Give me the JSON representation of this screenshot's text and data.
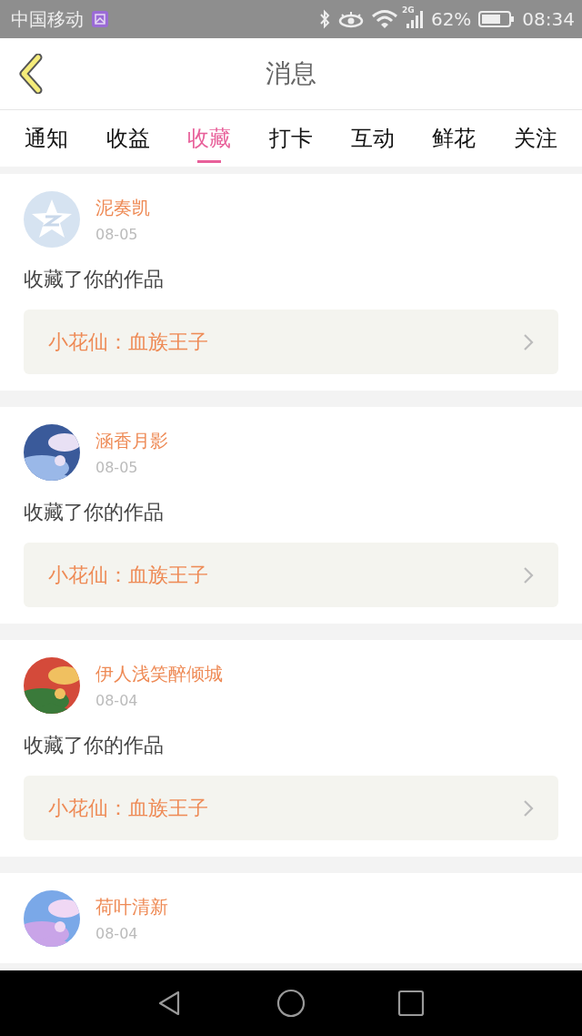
{
  "status_bar": {
    "carrier": "中国移动",
    "battery": "62%",
    "time": "08:34",
    "network": "2G"
  },
  "header": {
    "title": "消息"
  },
  "tabs": [
    {
      "label": "通知",
      "selected": false
    },
    {
      "label": "收益",
      "selected": false
    },
    {
      "label": "收藏",
      "selected": true
    },
    {
      "label": "打卡",
      "selected": false
    },
    {
      "label": "互动",
      "selected": false
    },
    {
      "label": "鲜花",
      "selected": false
    },
    {
      "label": "关注",
      "selected": false
    }
  ],
  "messages": [
    {
      "kind": "default",
      "name": "泥奏凯",
      "date": "08-05",
      "text": "收藏了你的作品",
      "work": "小花仙：血族王子"
    },
    {
      "kind": "picture",
      "name": "涵香月影",
      "date": "08-05",
      "text": "收藏了你的作品",
      "work": "小花仙：血族王子"
    },
    {
      "kind": "picture",
      "name": "伊人浅笑醉倾城",
      "date": "08-04",
      "text": "收藏了你的作品",
      "work": "小花仙：血族王子"
    },
    {
      "kind": "picture",
      "name": "荷叶清新",
      "date": "08-04"
    }
  ]
}
